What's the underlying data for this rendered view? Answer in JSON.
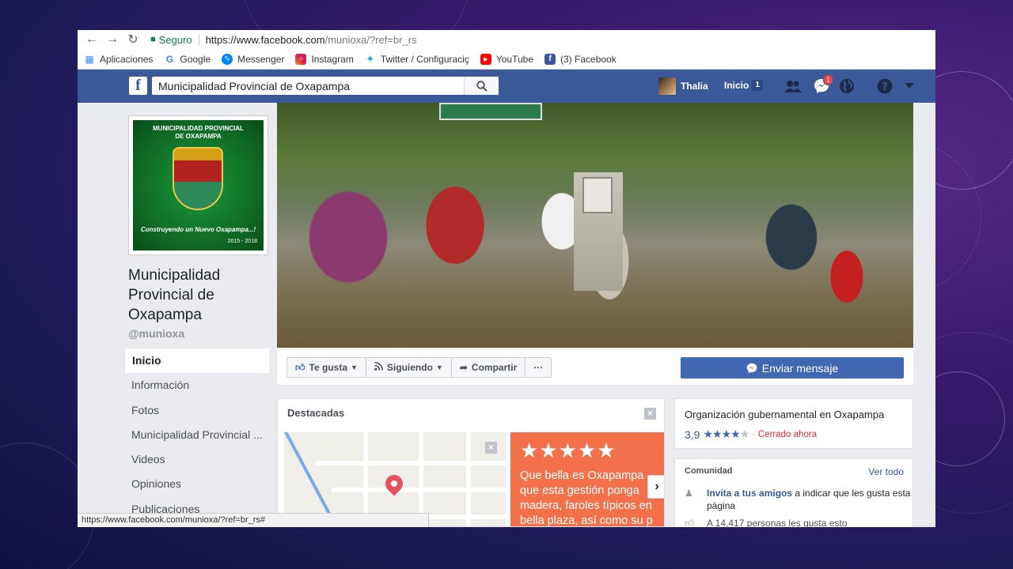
{
  "browser": {
    "secure_label": "Seguro",
    "url_host": "https://www.facebook.com",
    "url_path": "/munioxa/?ref=br_rs",
    "status_url": "https://www.facebook.com/munioxa/?ref=br_rs#"
  },
  "bookmarks": [
    {
      "label": "Aplicaciones",
      "icon": "apps-grid-icon"
    },
    {
      "label": "Google",
      "icon": "google-icon"
    },
    {
      "label": "Messenger",
      "icon": "messenger-icon"
    },
    {
      "label": "Instagram",
      "icon": "instagram-icon"
    },
    {
      "label": "Twitter / Configuraciç",
      "icon": "twitter-icon"
    },
    {
      "label": "YouTube",
      "icon": "youtube-icon"
    },
    {
      "label": "(3) Facebook",
      "icon": "facebook-icon"
    }
  ],
  "fb_header": {
    "search_value": "Municipalidad Provincial de Oxapampa",
    "user_name": "Thalia",
    "home_label": "Inicio",
    "home_count": "1",
    "messages_badge": "1"
  },
  "page": {
    "logo": {
      "title_line1": "MUNICIPALIDAD PROVINCIAL",
      "title_line2": "DE OXAPAMPA",
      "slogan": "Construyendo un Nuevo Oxapampa...!",
      "years": "2015 - 2018"
    },
    "name": "Municipalidad Provincial de Oxapampa",
    "handle": "@munioxa"
  },
  "left_nav": [
    {
      "label": "Inicio",
      "active": true
    },
    {
      "label": "Información",
      "active": false
    },
    {
      "label": "Fotos",
      "active": false
    },
    {
      "label": "Municipalidad Provincial ...",
      "active": false
    },
    {
      "label": "Videos",
      "active": false
    },
    {
      "label": "Opiniones",
      "active": false
    },
    {
      "label": "Publicaciones",
      "active": false
    }
  ],
  "actions": {
    "like": "Te gusta",
    "follow": "Siguiendo",
    "share": "Compartir",
    "more": "···",
    "message": "Enviar mensaje"
  },
  "featured": {
    "title": "Destacadas",
    "review_stars": "★★★★★",
    "review_lines": [
      "Que bella es Oxapampa",
      "que esta gestión ponga",
      "madera, faroles típicos en",
      "bella plaza, así como su p"
    ]
  },
  "about": {
    "category": "Organización gubernamental en Oxapampa",
    "rating_value": "3,9",
    "rating_stars_on": "★★★★",
    "rating_stars_off": "★",
    "dot": "·",
    "open_status": "Cerrado ahora"
  },
  "community": {
    "title": "Comunidad",
    "see_all": "Ver todo",
    "invite_link": "Invita a tus amigos",
    "invite_rest": " a indicar que les gusta esta página",
    "likes_text": "A 14.417 personas les gusta esto"
  },
  "colors": {
    "fb_blue": "#3b5998",
    "button_blue": "#4267b2",
    "secure_green": "#0b8043",
    "review_orange": "#f2714a",
    "closed_red": "#e9283b"
  }
}
